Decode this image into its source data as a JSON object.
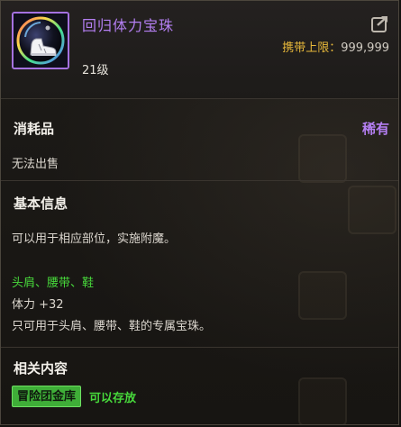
{
  "item": {
    "name": "回归体力宝珠",
    "carry_label": "携带上限：",
    "carry_value": "999,999",
    "level": "21级",
    "rarity_color": "#b47ff2"
  },
  "category": {
    "title": "消耗品",
    "rarity": "稀有",
    "sell_status": "无法出售"
  },
  "basic_info": {
    "title": "基本信息",
    "description": "可以用于相应部位，实施附魔。",
    "slots": "头肩、腰带、鞋",
    "stat": "体力 +32",
    "restriction": "只可用于头肩、腰带、鞋的专属宝珠。"
  },
  "related": {
    "title": "相关内容",
    "storage_button": "冒险团金库",
    "storage_text": "可以存放"
  },
  "icons": {
    "item": "boot-orb-icon",
    "export": "export-arrow-icon"
  },
  "colors": {
    "green": "#47d83b",
    "gold": "#e7b83a"
  }
}
